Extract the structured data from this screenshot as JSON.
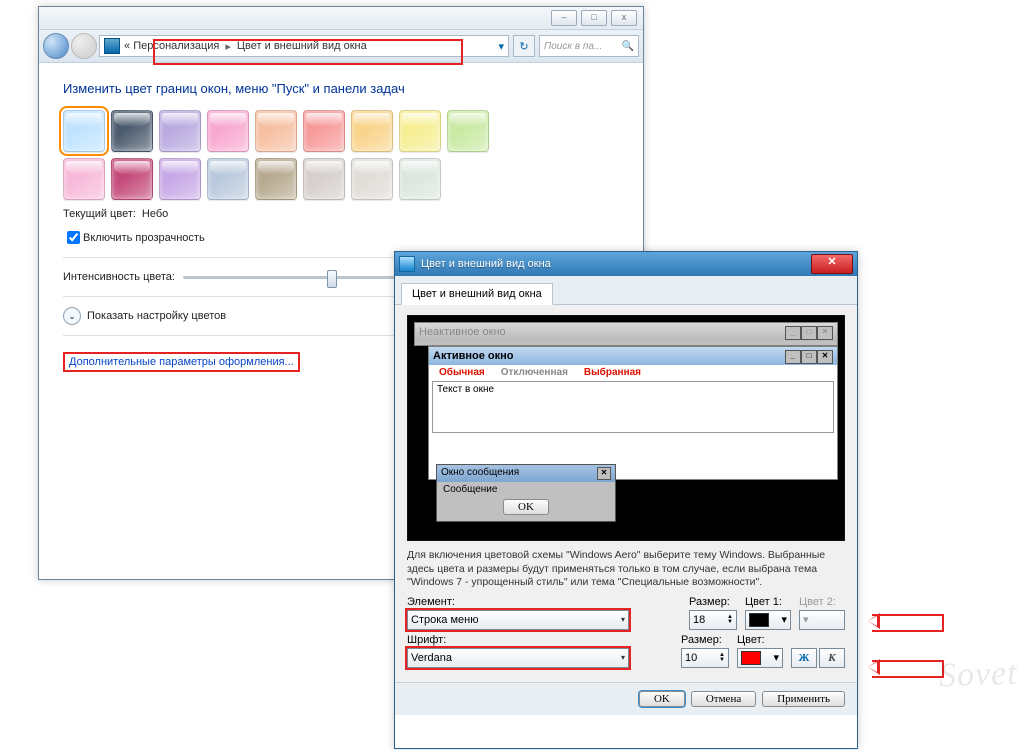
{
  "win1": {
    "min": "–",
    "max": "□",
    "close": "x",
    "crumb_prefix": "«",
    "crumb1": "Персонализация",
    "crumb2": "Цвет и внешний вид окна",
    "search_placeholder": "Поиск в па...",
    "dropdown": "▾",
    "refresh": "↻",
    "mag": "🔍",
    "heading": "Изменить цвет границ окон, меню \"Пуск\" и панели задач",
    "swatches1": [
      "#bfe3ff",
      "#4a5a6d",
      "#b9a9e0",
      "#f8a8d0",
      "#f6bfa0",
      "#f79a9a",
      "#f9d38a",
      "#f6ee92",
      "#c9eaa3"
    ],
    "swatches2": [
      "#f7b9d9",
      "#c44a7a",
      "#c7a8e6",
      "#b9c9dd",
      "#b7a98f",
      "#d6cfcc",
      "#e0ddd7",
      "#dbe6de"
    ],
    "curcolor_lbl": "Текущий цвет:",
    "curcolor_val": "Небо",
    "transparency": "Включить прозрачность",
    "intensity": "Интенсивность цвета:",
    "show_mixer": "Показать настройку цветов",
    "chev": "⌄",
    "adv_link": "Дополнительные параметры оформления..."
  },
  "dlg": {
    "title": "Цвет и внешний вид окна",
    "close": "✕",
    "tab": "Цвет и внешний вид окна",
    "preview": {
      "inactive": "Неактивное окно",
      "active": "Активное окно",
      "m1": "Обычная",
      "m2": "Отключенная",
      "m3": "Выбранная",
      "text": "Текст в окне",
      "msg_title": "Окно сообщения",
      "msg_body": "Сообщение",
      "msg_ok": "OK",
      "x": "✕",
      "min": "_",
      "max": "□",
      "close": "✕"
    },
    "info": "Для включения цветовой схемы \"Windows Aero\" выберите тему Windows. Выбранные здесь цвета и размеры будут применяться только в том случае, если выбрана тема \"Windows 7 - упрощенный стиль\" или тема \"Специальные возможности\".",
    "element_lbl": "Элемент:",
    "element_val": "Строка меню",
    "size_lbl": "Размер:",
    "size1": "18",
    "size2": "10",
    "color1_lbl": "Цвет 1:",
    "color2_lbl": "Цвет 2:",
    "font_lbl": "Шрифт:",
    "font_val": "Verdana",
    "fcolor_lbl": "Цвет:",
    "color1": "#000000",
    "fcolor": "#ff0000",
    "bold": "Ж",
    "ital": "К",
    "dd": "▾",
    "spinup": "▲",
    "spindn": "▼",
    "ok": "OK",
    "cancel": "Отмена",
    "apply": "Применить"
  },
  "watermark": "Sovet"
}
